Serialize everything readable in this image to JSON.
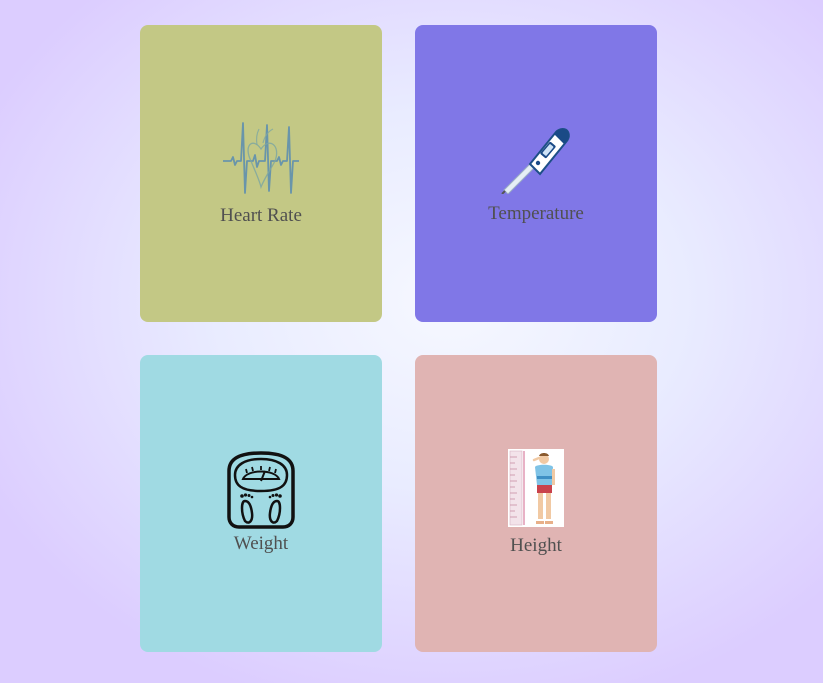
{
  "cards": [
    {
      "label": "Heart Rate",
      "icon": "heart-rate-icon",
      "color": "#c3c885"
    },
    {
      "label": "Temperature",
      "icon": "thermometer-icon",
      "color": "#8077e7"
    },
    {
      "label": "Weight",
      "icon": "weighing-scale-icon",
      "color": "#a0dae3"
    },
    {
      "label": "Height",
      "icon": "height-chart-icon",
      "color": "#e0b4b3"
    }
  ]
}
